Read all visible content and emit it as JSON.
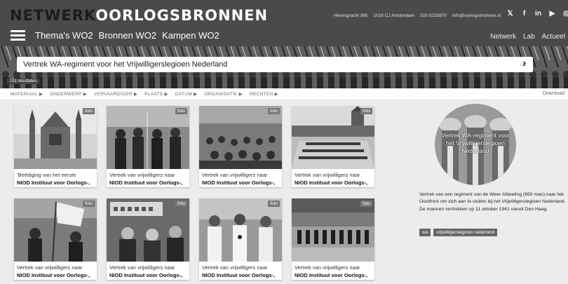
{
  "brand": {
    "part1": "NETWERK",
    "part2": "OORLOGSBRONNEN"
  },
  "contact": [
    "Herengracht 380",
    "1016 CJ Amsterdam",
    "020-5233870",
    "info@oorlogsbronnen.nl"
  ],
  "social": [
    {
      "icon": "twitter-icon",
      "glyph": "𝕏"
    },
    {
      "icon": "facebook-icon",
      "glyph": "f"
    },
    {
      "icon": "linkedin-icon",
      "glyph": "in"
    },
    {
      "icon": "youtube-icon",
      "glyph": "▶"
    },
    {
      "icon": "instagram-icon",
      "glyph": "◎"
    }
  ],
  "nav": {
    "items": [
      "Thema's WO2",
      "Bronnen WO2",
      "Kampen WO2"
    ],
    "right": [
      "Netwerk",
      "Lab",
      "Actueel"
    ]
  },
  "search": {
    "value": "Vertrek WA-regiment voor het Vrijwilligerslegioen Nederland",
    "results": "151 resultaten"
  },
  "filters": [
    "MATERIAAL ▶",
    "ONDERWERP ▶",
    "VERVAARDIGER ▶",
    "PLAATS ▶",
    "DATUM ▶",
    "ORGANISATIE ▶",
    "RECHTEN ▶"
  ],
  "download": "Download",
  "cards": [
    {
      "badge": "foto",
      "title": "'Beëdiging van het eerste",
      "source": "NIOD Instituut voor Oorlogs-,"
    },
    {
      "badge": "foto",
      "title": "Vertrek van vrijwilligers naar",
      "source": "NIOD Instituut voor Oorlogs-,"
    },
    {
      "badge": "foto",
      "title": "Vertrek van vrijwilligers naar",
      "source": "NIOD Instituut voor Oorlogs-,"
    },
    {
      "badge": "foto",
      "title": "Vertrek van vrijwilligers naar",
      "source": "NIOD Instituut voor Oorlogs-,"
    },
    {
      "badge": "foto",
      "title": "Vertrek van vrijwilligers naar",
      "source": "NIOD Instituut voor Oorlogs-,"
    },
    {
      "badge": "foto",
      "title": "Vertrek van vrijwilligers naar",
      "source": "NIOD Instituut voor Oorlogs-,"
    },
    {
      "badge": "foto",
      "title": "Vertrek van vrijwilligers naar",
      "source": "NIOD Instituut voor Oorlogs-,"
    },
    {
      "badge": "foto",
      "title": "Vertrek van vrijwilligers naar",
      "source": "NIOD Instituut voor Oorlogs-,"
    }
  ],
  "detail": {
    "caption": "Vertrek WA-regiment voor het Vrijwilligerslegioen Nederland",
    "description": "Vertrek van een regiment van de Weer Afdeeling (650 man) naar het Oostfront om zich aan te sluiten bij het Vrijwilligerslegioen Nederland. De mannen vertrokken op 11 oktober 1941 vanuit Den Haag.",
    "tags": [
      "wa",
      "vrijwilligerslegioen nederland"
    ]
  }
}
